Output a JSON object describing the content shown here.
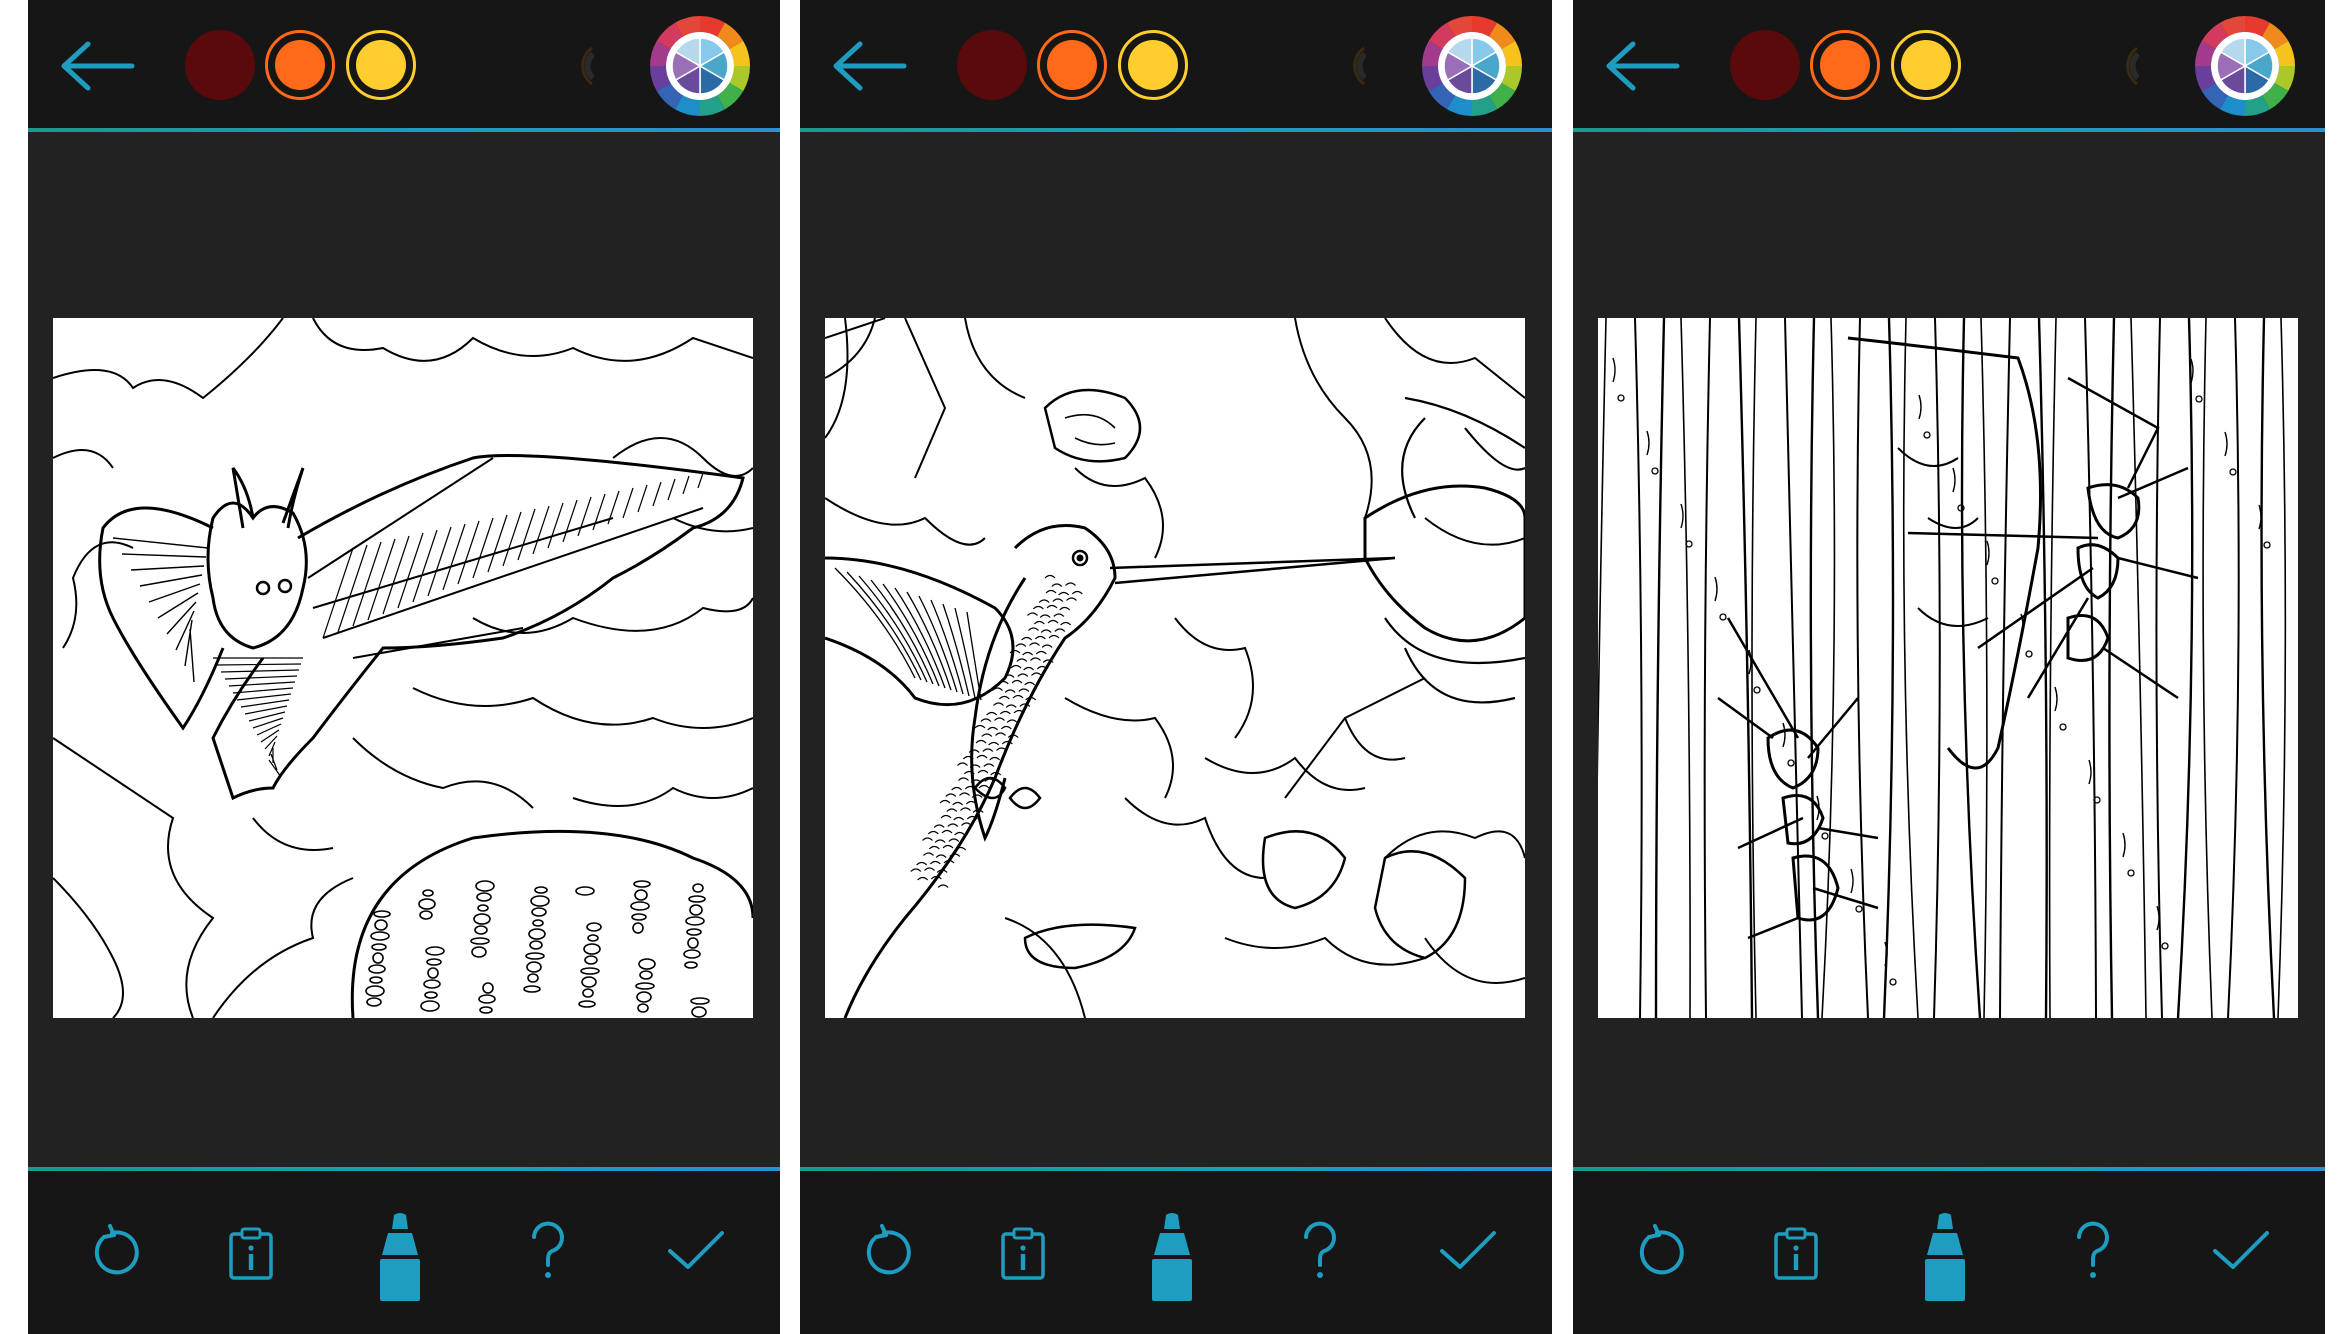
{
  "screens": [
    {
      "name": "bat-page",
      "subject": "bat"
    },
    {
      "name": "hummingbird-page",
      "subject": "hummingbird"
    },
    {
      "name": "ant-page",
      "subject": "ants"
    }
  ],
  "palette": {
    "swatches": [
      {
        "color": "#5a0a0a",
        "style": "filled"
      },
      {
        "color": "#ff6a1a",
        "style": "ringed"
      },
      {
        "color": "#ffce2e",
        "style": "ringed"
      },
      {
        "color": "#3a2a10",
        "style": "partial"
      }
    ],
    "accent": "#1f9dc0",
    "topbar_bg": "#161616",
    "workspace_bg": "#222222"
  },
  "toolbar": {
    "top": [
      "back-arrow-icon",
      "color-swatches",
      "color-wheel-icon"
    ],
    "bottom": [
      "undo-icon",
      "info-clipboard-icon",
      "marker-icon",
      "help-icon",
      "checkmark-icon"
    ]
  }
}
